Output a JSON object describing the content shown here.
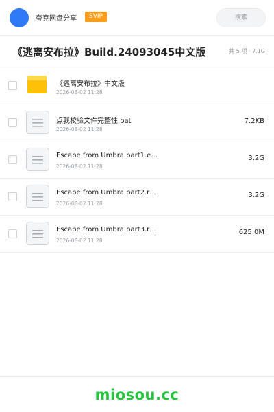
{
  "header": {
    "app_name": "夸克网盘分享",
    "badge": "SVIP",
    "search_placeholder": "搜索",
    "avatar_color": "#2f7af7",
    "badge_color": "#ff9c1a"
  },
  "share": {
    "title": "《逃离安布拉》Build.24093045中文版",
    "summary": "共 5 项 · 7.1G"
  },
  "files": [
    {
      "icon": "folder-icon",
      "name": "《逃离安布拉》中文版",
      "date": "2026-08-02 11:28",
      "size": ""
    },
    {
      "icon": "file-icon",
      "name": "点我校验文件完整性.bat",
      "date": "2026-08-02 11:28",
      "size": "7.2KB"
    },
    {
      "icon": "file-icon",
      "name": "Escape from Umbra.part1.e…",
      "date": "2026-08-02 11:28",
      "size": "3.2G"
    },
    {
      "icon": "file-icon",
      "name": "Escape from Umbra.part2.r…",
      "date": "2026-08-02 11:28",
      "size": "3.2G"
    },
    {
      "icon": "file-icon",
      "name": "Escape from Umbra.part3.r…",
      "date": "2026-08-02 11:28",
      "size": "625.0M"
    }
  ],
  "footer": {
    "watermark": "miosou.cc",
    "watermark_color": "#27c33f"
  }
}
